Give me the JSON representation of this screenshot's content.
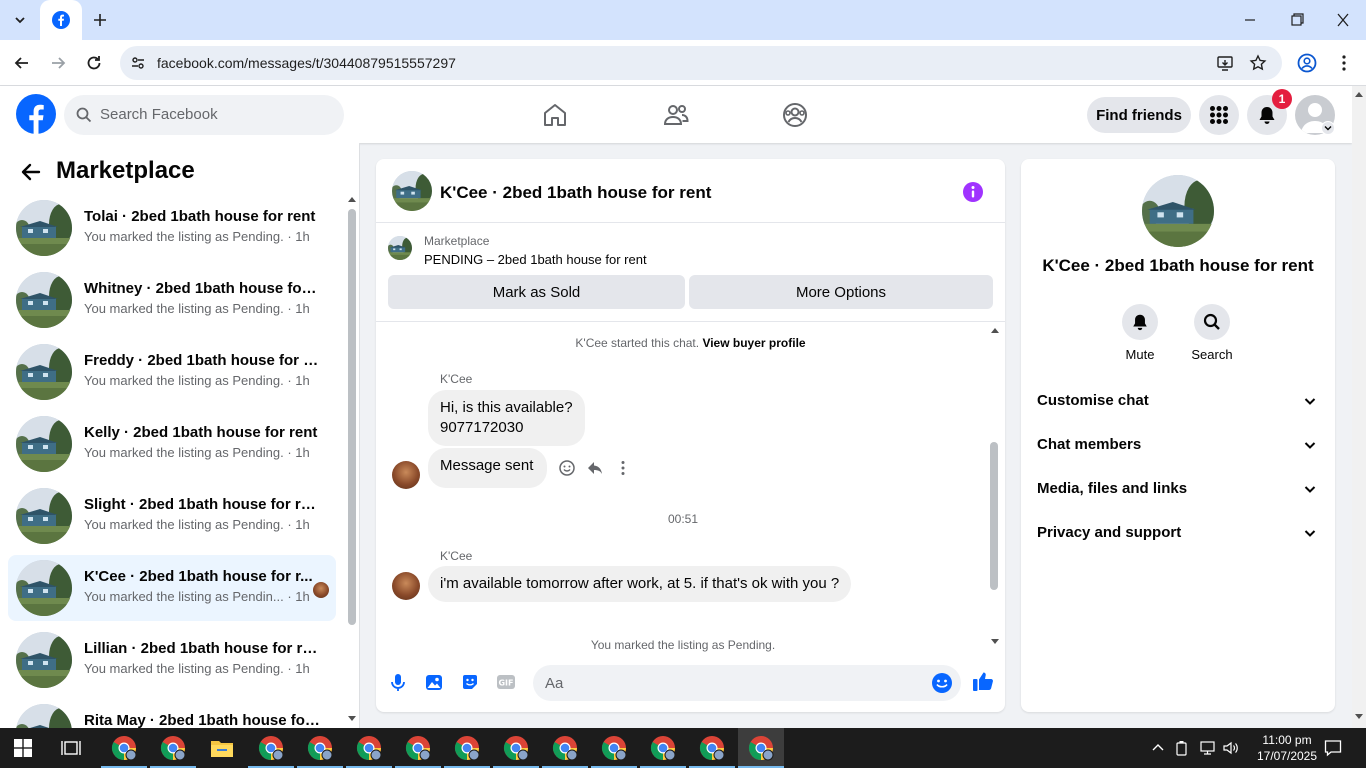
{
  "browser": {
    "url": "facebook.com/messages/t/30440879515557297"
  },
  "header": {
    "search_placeholder": "Search Facebook",
    "find_friends": "Find friends",
    "notification_count": "1"
  },
  "sidebar": {
    "title": "Marketplace",
    "items": [
      {
        "name": "Tolai · 2bed 1bath house for rent",
        "sub": "You marked the listing as Pending.",
        "time": "· 1h"
      },
      {
        "name": "Whitney · 2bed 1bath house for ...",
        "sub": "You marked the listing as Pending.",
        "time": "· 1h"
      },
      {
        "name": "Freddy · 2bed 1bath house for re...",
        "sub": "You marked the listing as Pending.",
        "time": "· 1h"
      },
      {
        "name": "Kelly · 2bed 1bath house for rent",
        "sub": "You marked the listing as Pending.",
        "time": "· 1h"
      },
      {
        "name": "Slight · 2bed 1bath house for rent",
        "sub": "You marked the listing as Pending.",
        "time": "· 1h"
      },
      {
        "name": "K'Cee · 2bed 1bath house for r...",
        "sub": "You marked the listing as Pendin...",
        "time": "· 1h"
      },
      {
        "name": "Lillian · 2bed 1bath house for rent",
        "sub": "You marked the listing as Pending.",
        "time": "· 1h"
      },
      {
        "name": "Rita May · 2bed 1bath house for ...",
        "sub": "",
        "time": ""
      }
    ]
  },
  "chat": {
    "title": "K'Cee · 2bed 1bath house for rent",
    "marketplace_label": "Marketplace",
    "listing_status": "PENDING – 2bed 1bath house for rent",
    "mark_sold": "Mark as Sold",
    "more_options": "More Options",
    "started_text": "K'Cee started this chat.",
    "view_profile": "View buyer profile",
    "sender1": "K'Cee",
    "msg1_line1": "Hi, is this available?",
    "msg1_line2": "9077172030",
    "msg2": "Message sent",
    "timestamp": "00:51",
    "sender2": "K'Cee",
    "msg3": "i'm available tomorrow after work, at 5. if that's ok with you ?",
    "pending_note": "You marked the listing as Pending.",
    "composer_placeholder": "Aa"
  },
  "info_panel": {
    "name": "K'Cee · 2bed 1bath house for rent",
    "mute": "Mute",
    "search": "Search",
    "sections": [
      "Customise chat",
      "Chat members",
      "Media, files and links",
      "Privacy and support"
    ]
  },
  "taskbar": {
    "time": "11:00 pm",
    "date": "17/07/2025"
  },
  "colors": {
    "fb_blue": "#0866ff",
    "accent_purple": "#a033ff",
    "badge_red": "#e41e3f"
  }
}
